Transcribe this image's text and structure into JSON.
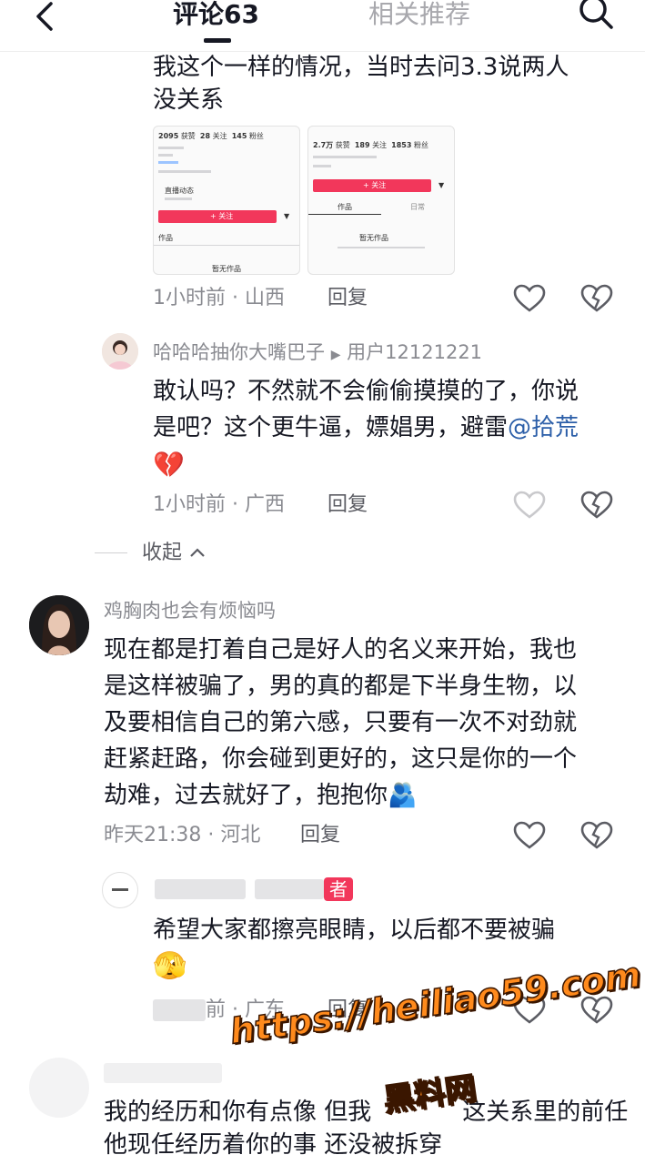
{
  "header": {
    "tab_comments": "评论63",
    "tab_related": "相关推荐"
  },
  "comment1": {
    "text_line1": "我这个一样的情况，当时去问3.3说两人",
    "text_line2": "没关系",
    "time": "1小时前",
    "location": "山西",
    "reply_label": "回复",
    "screenshot_left": {
      "likes": "2095",
      "likes_label": "获赞",
      "following": "28",
      "following_label": "关注",
      "followers": "145",
      "followers_label": "粉丝",
      "live_label": "直播动态",
      "follow_btn": "+ 关注",
      "works": "作品",
      "no_works": "暂无作品"
    },
    "screenshot_right": {
      "likes": "2.7万",
      "likes_label": "获赞",
      "following": "189",
      "following_label": "关注",
      "followers": "1853",
      "followers_label": "粉丝",
      "follow_btn": "+ 关注",
      "works": "作品",
      "daily": "日常",
      "no_works": "暂无作品"
    }
  },
  "reply1": {
    "username": "哈哈哈抽你大嘴巴子",
    "reply_to": "用户12121221",
    "text_line1": "敢认吗？不然就不会偷偷摸摸的了，你说",
    "text_line2a": "是吧？这个更牛逼，嫖娼男，避雷",
    "mention": "@拾荒",
    "emoji": "💔",
    "time": "1小时前",
    "location": "广西",
    "reply_label": "回复"
  },
  "collapse": {
    "label": "收起"
  },
  "comment2": {
    "username": "鸡胸肉也会有烦恼吗",
    "lines": [
      "现在都是打着自己是好人的名义来开始，我也",
      "是这样被骗了，男的真的都是下半身生物，以",
      "及要相信自己的第六感，只要有一次不对劲就",
      "赶紧赶路，你会碰到更好的，这只是你的一个",
      "劫难，过去就好了，抱抱你"
    ],
    "emoji": "🫂",
    "time": "昨天21:38",
    "location": "河北",
    "reply_label": "回复"
  },
  "reply2": {
    "author_badge": "者",
    "text_line1": "希望大家都擦亮眼睛，以后都不要被骗",
    "emoji": "🫣",
    "time": "前",
    "location": "广东",
    "reply_label": "回复"
  },
  "comment3": {
    "text_line1": "我的经历和你有点像 但我",
    "text_line1b": "这关系里的前任",
    "text_line2": "他现任经历着你的事 还没被拆穿"
  },
  "watermark": {
    "url": "https://heiliao59.com",
    "name": "黑料网"
  },
  "separator": "·",
  "colors": {
    "accent_red": "#f2375b",
    "mention_blue": "#2b5ea8",
    "meta_gray": "#8a8b91"
  }
}
